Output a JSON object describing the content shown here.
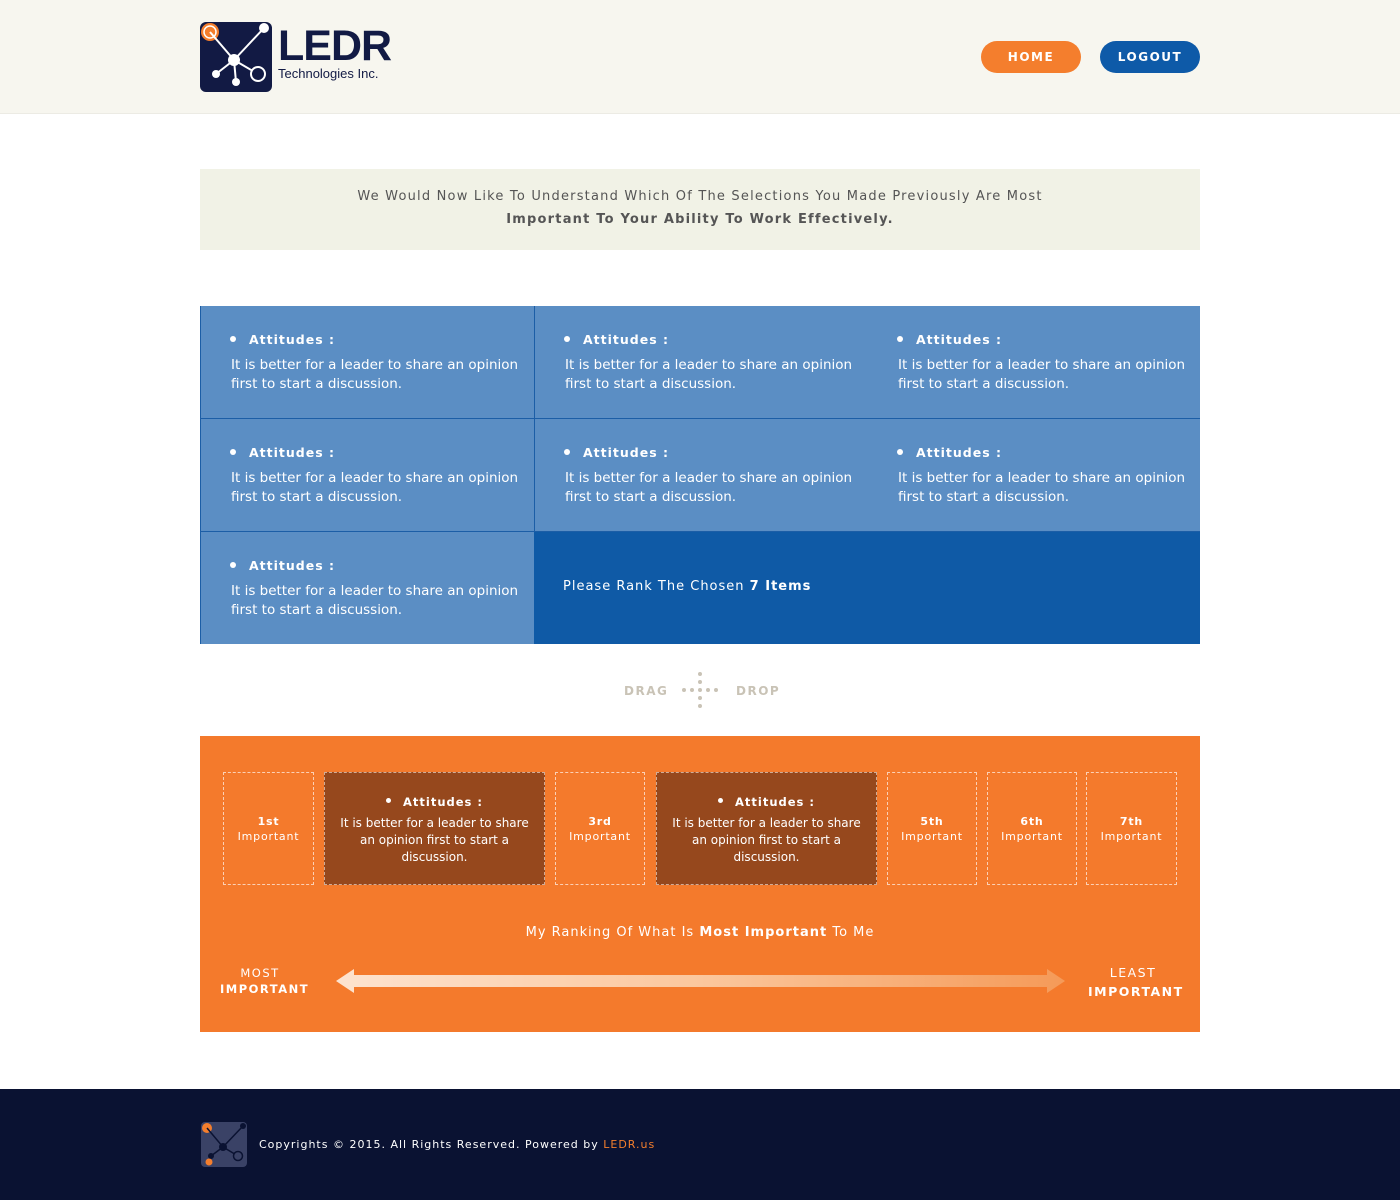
{
  "header": {
    "logo_name": "LEDR",
    "logo_sub": "Technologies Inc.",
    "home_label": "HOME",
    "logout_label": "LOGOUT"
  },
  "intro": {
    "line1": "We Would Now Like To Understand Which Of The Selections You Made Previously Are Most",
    "line2": "Important To Your Ability To Work Effectively."
  },
  "selections": [
    {
      "title": "Attitudes :",
      "text": "It is better for a leader to share an opinion first to start a discussion."
    },
    {
      "title": "Attitudes :",
      "text": "It is better for a leader to share an opinion first to start a discussion."
    },
    {
      "title": "Attitudes :",
      "text": "It is better for a leader to share an opinion first to start a discussion."
    },
    {
      "title": "Attitudes :",
      "text": "It is better for a leader to share an opinion first to start a discussion."
    },
    {
      "title": "Attitudes :",
      "text": "It is better for a leader to share an opinion first to start a discussion."
    },
    {
      "title": "Attitudes :",
      "text": "It is better for a leader to share an opinion first to start a discussion."
    },
    {
      "title": "Attitudes :",
      "text": "It is better for a leader to share an opinion first to start a discussion."
    }
  ],
  "rank_prompt": {
    "prefix": "Please Rank The Chosen",
    "count": "7 Items"
  },
  "drag_drop": {
    "drag": "DRAG",
    "drop": "DROP"
  },
  "slots": [
    {
      "num": "1st",
      "label": "Important"
    },
    {
      "title": "Attitudes :",
      "text": "It is better for a leader to share an opinion first to start a discussion."
    },
    {
      "num": "3rd",
      "label": "Important"
    },
    {
      "title": "Attitudes :",
      "text": "It is better for a leader to share an opinion first to start a discussion."
    },
    {
      "num": "5th",
      "label": "Important"
    },
    {
      "num": "6th",
      "label": "Important"
    },
    {
      "num": "7th",
      "label": "Important"
    }
  ],
  "ranking": {
    "pre": "My Ranking Of What Is",
    "bold": "Most Important",
    "post": "To Me",
    "most_1": "MOST",
    "most_2": "IMPORTANT",
    "least_1": "LEAST",
    "least_2": "IMPORTANT"
  },
  "footer": {
    "copyright": "Copyrights © 2015. All Rights Reserved. Powered by",
    "link": "LEDR.us"
  },
  "colors": {
    "orange": "#f47a2c",
    "navy": "#0a1232",
    "blue": "#0f5aa6",
    "light_blue": "#5b8ec4",
    "brown": "#96481d"
  },
  "icons": [
    "ledr-logo-icon",
    "drag-drop-icon",
    "ranking-arrow-icon"
  ]
}
